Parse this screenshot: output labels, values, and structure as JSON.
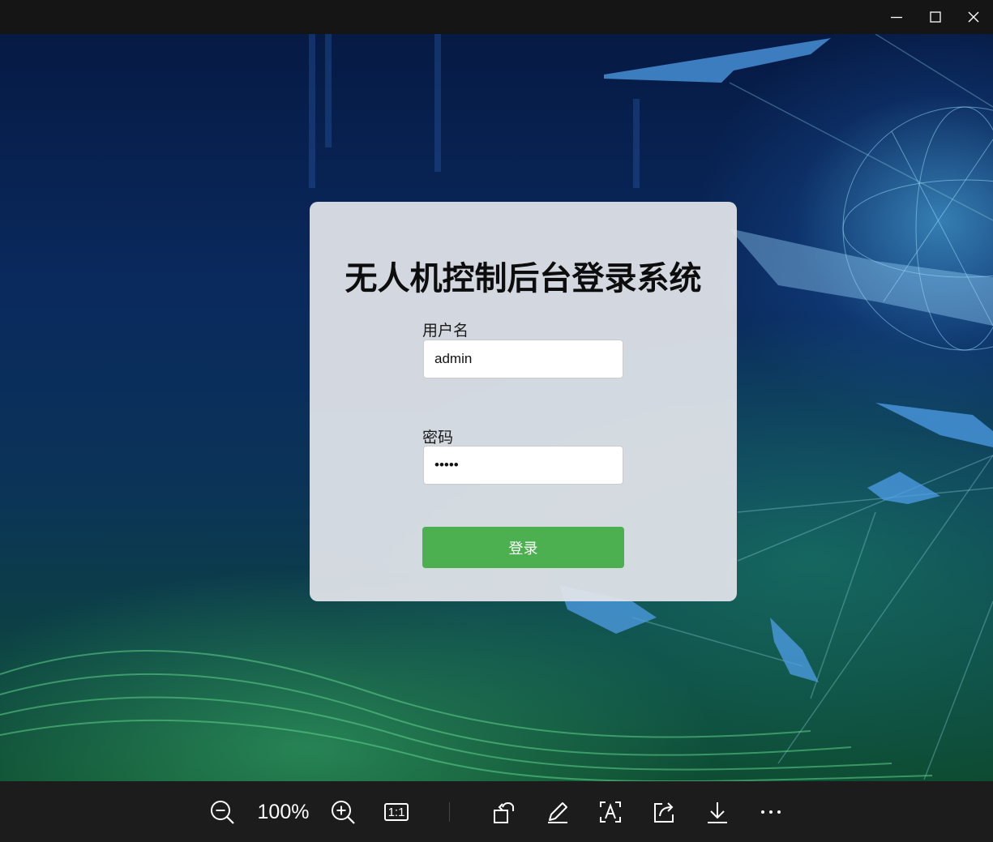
{
  "window_controls": {
    "minimize": "minimize-icon",
    "maximize": "maximize-icon",
    "close": "close-icon"
  },
  "login": {
    "title": "无人机控制后台登录系统",
    "username_label": "用户名",
    "username_value": "admin",
    "password_label": "密码",
    "password_value": "admin",
    "submit_label": "登录",
    "submit_color": "#4caf50"
  },
  "toolbar": {
    "zoom_level": "100%",
    "actual_size_label": "1:1",
    "icons": [
      "zoom-out-icon",
      "zoom-in-icon",
      "actual-size-icon",
      "rotate-icon",
      "edit-icon",
      "text-recognition-icon",
      "share-icon",
      "save-icon",
      "more-icon"
    ]
  }
}
